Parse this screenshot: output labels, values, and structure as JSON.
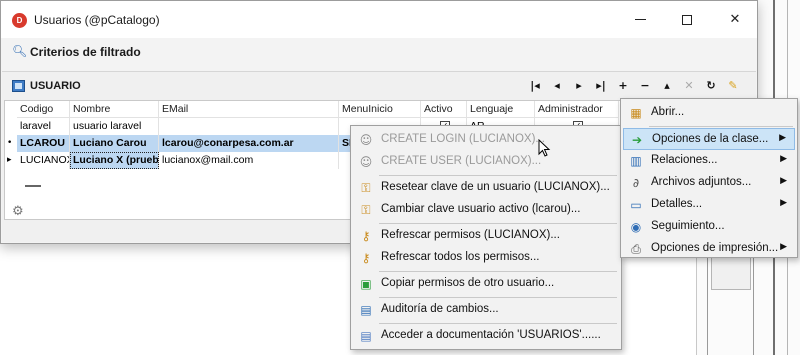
{
  "window": {
    "title": "Usuarios (@pCatalogo)",
    "filter_label": "Criterios de filtrado",
    "panel_title": "USUARIO"
  },
  "grid": {
    "columns": [
      "Codigo",
      "Nombre",
      "EMail",
      "MenuInicio",
      "Activo",
      "Lenguaje",
      "Administrador"
    ],
    "rows": [
      {
        "codigo": "laravel",
        "nombre": "usuario laravel",
        "email": "",
        "menu": "",
        "activo": "✓",
        "lenguaje": "AR",
        "admin": "✓"
      },
      {
        "codigo": "LCAROU",
        "nombre": "Luciano Carou",
        "email": "lcarou@conarpesa.com.ar",
        "menu": "SI",
        "activo": "",
        "lenguaje": "",
        "admin": ""
      },
      {
        "codigo": "LUCIANOX",
        "nombre": "Luciano X (prueba",
        "email": "lucianox@mail.com",
        "menu": "",
        "activo": "",
        "lenguaje": "",
        "admin": ""
      }
    ]
  },
  "context_menu": {
    "items": [
      {
        "label": "CREATE LOGIN (LUCIANOX)...",
        "icon": "user-off-icon",
        "disabled": true
      },
      {
        "label": "CREATE USER (LUCIANOX)...",
        "icon": "user-add-icon",
        "disabled": true
      },
      {
        "label": "Resetear clave de un usuario (LUCIANOX)...",
        "icon": "key-icon"
      },
      {
        "label": "Cambiar clave usuario activo (lcarou)...",
        "icon": "key-change-icon"
      },
      {
        "label": "Refrescar permisos (LUCIANOX)...",
        "icon": "refresh-key-icon"
      },
      {
        "label": "Refrescar todos los permisos...",
        "icon": "refresh-all-icon"
      },
      {
        "label": "Copiar permisos de otro usuario...",
        "icon": "copy-icon"
      },
      {
        "label": "Auditoría de cambios...",
        "icon": "audit-icon"
      },
      {
        "label": "Acceder a documentación 'USUARIOS'......",
        "icon": "doc-icon"
      }
    ]
  },
  "submenu": {
    "items": [
      {
        "label": "Abrir..."
      },
      {
        "label": "Opciones de la clase..."
      },
      {
        "label": "Relaciones..."
      },
      {
        "label": "Archivos adjuntos..."
      },
      {
        "label": "Detalles..."
      },
      {
        "label": "Seguimiento..."
      },
      {
        "label": "Opciones de impresión..."
      }
    ]
  },
  "colors": {
    "selection": "#bcd7f2",
    "menu_highlight": "#cce4f7",
    "app_icon": "#d83a2d"
  }
}
